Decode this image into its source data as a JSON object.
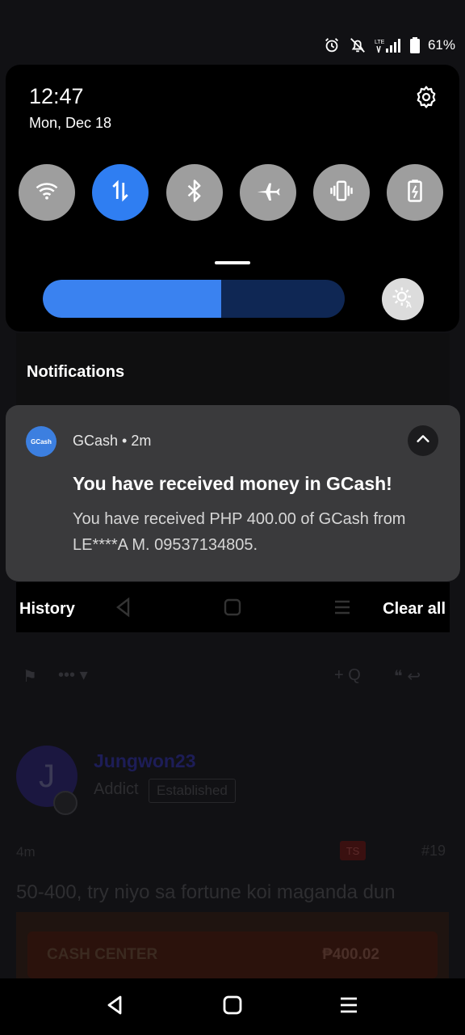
{
  "status_bar": {
    "icons": [
      "alarm-icon",
      "mute-icon",
      "lte-signal-icon",
      "battery-icon"
    ],
    "battery_percent": "61%"
  },
  "quick_settings": {
    "time": "12:47",
    "date": "Mon, Dec 18",
    "tiles": [
      {
        "name": "wifi",
        "icon": "wifi-icon",
        "active": false
      },
      {
        "name": "mobile-data",
        "icon": "data-arrows-icon",
        "active": true
      },
      {
        "name": "bluetooth",
        "icon": "bluetooth-icon",
        "active": false
      },
      {
        "name": "airplane-mode",
        "icon": "airplane-icon",
        "active": false
      },
      {
        "name": "vibrate",
        "icon": "vibrate-icon",
        "active": false
      },
      {
        "name": "battery-saver",
        "icon": "battery-saver-icon",
        "active": false
      }
    ],
    "brightness_level": 0.59,
    "colors": {
      "active_tile": "#2f7ef2",
      "inactive_tile": "#9e9e9e",
      "brightness_fill": "#3a82f0",
      "brightness_track": "#0f2754"
    }
  },
  "notifications": {
    "header": "Notifications",
    "items": [
      {
        "app_icon_text": "GCash",
        "app_name": "GCash",
        "separator": "•",
        "time": "2m",
        "title": "You have received money in GCash!",
        "body": "You have received PHP 400.00 of GCash from LE****A M. 09537134805."
      }
    ],
    "history_label": "History",
    "clear_all_label": "Clear all"
  },
  "background_app": {
    "username": "Jungwon23",
    "rank": "Addict",
    "badge": "Established",
    "avatar_letter": "J",
    "post_time": "4m",
    "ts_label": "TS",
    "post_number": "#19",
    "post_text": "50-400, try niyo sa fortune koi maganda dun",
    "cash_center_label": "CASH CENTER",
    "cash_amount": "₱400.02"
  }
}
